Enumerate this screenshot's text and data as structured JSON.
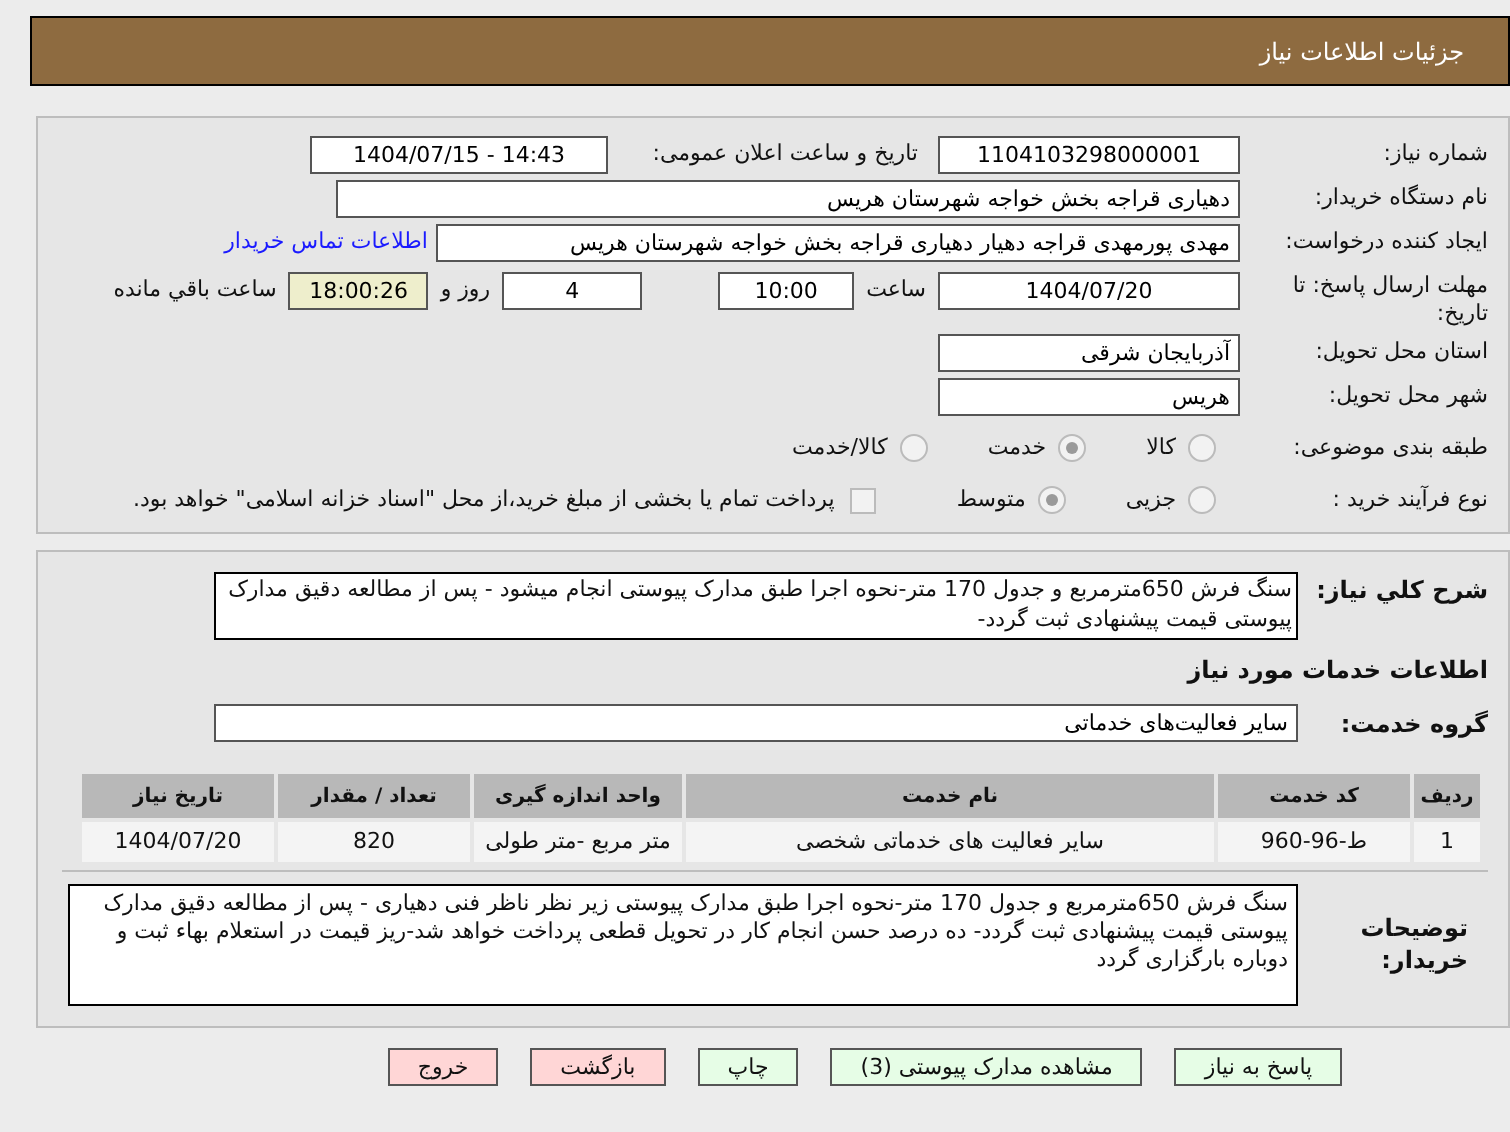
{
  "header": {
    "title": "جزئیات اطلاعات نیاز"
  },
  "details": {
    "need_number": {
      "label": "شماره نیاز:",
      "value": "1104103298000001"
    },
    "announce_date": {
      "label": "تاریخ و ساعت اعلان عمومی:",
      "value": "1404/07/15 - 14:43"
    },
    "buyer_org": {
      "label": "نام دستگاه خریدار:",
      "value": "دهیاری قراجه بخش خواجه شهرستان هریس"
    },
    "creator": {
      "label": "ایجاد کننده درخواست:",
      "value": "مهدی پورمهدی قراجه دهیار دهیاری قراجه بخش خواجه شهرستان هریس",
      "link": "اطلاعات تماس خریدار"
    },
    "deadline": {
      "label": "مهلت ارسال پاسخ: تا تاریخ:",
      "date": "1404/07/20",
      "time_label": "ساعت",
      "time": "10:00",
      "days": "4",
      "days_label": "روز و",
      "remaining": "18:00:26",
      "remaining_label": "ساعت باقي مانده"
    },
    "province": {
      "label": "استان محل تحویل:",
      "value": "آذربایجان شرقی"
    },
    "city": {
      "label": "شهر محل تحویل:",
      "value": "هریس"
    },
    "category": {
      "label": "طبقه بندی موضوعی:",
      "options": [
        {
          "label": "کالا",
          "selected": false
        },
        {
          "label": "خدمت",
          "selected": true
        },
        {
          "label": "کالا/خدمت",
          "selected": false
        }
      ]
    },
    "process": {
      "label": "نوع فرآیند خرید :",
      "options": [
        {
          "label": "جزیی",
          "selected": false
        },
        {
          "label": "متوسط",
          "selected": true
        }
      ],
      "payment": {
        "label": "پرداخت تمام یا بخشی از مبلغ خرید،از محل \"اسناد خزانه اسلامی\" خواهد بود.",
        "checked": false
      }
    }
  },
  "summary": {
    "label": "شرح کلي نیاز:",
    "value": "سنگ فرش 650مترمربع و جدول 170 متر-نحوه اجرا طبق مدارک پیوستی  انجام میشود - پس از مطالعه دقیق مدارک پیوستی قیمت پیشنهادی ثبت گردد-"
  },
  "services": {
    "title": "اطلاعات خدمات مورد نیاز",
    "group_label": "گروه خدمت:",
    "group": "سایر فعالیت‌های خدماتی",
    "columns": [
      "ردیف",
      "کد خدمت",
      "نام خدمت",
      "واحد اندازه گیری",
      "تعداد / مقدار",
      "تاریخ نیاز"
    ],
    "rows": [
      [
        "1",
        "ط-96-960",
        "سایر فعالیت های خدماتی شخصی",
        "متر مربع -متر طولی",
        "820",
        "1404/07/20"
      ]
    ]
  },
  "buyer_notes": {
    "label": "توضیحات خریدار:",
    "value": "سنگ فرش 650مترمربع و جدول 170 متر-نحوه اجرا طبق مدارک پیوستی زیر نظر ناظر فنی دهیاری - پس از مطالعه دقیق مدارک پیوستی قیمت پیشنهادی ثبت گردد- ده درصد حسن انجام کار در تحویل قطعی پرداخت خواهد شد-ریز قیمت در استعلام بهاء  ثبت و دوباره بارگزاری گردد"
  },
  "buttons": [
    {
      "label": "پاسخ به نیاز",
      "kind": "action"
    },
    {
      "label": "مشاهده مدارک پیوستی (3)",
      "kind": "action"
    },
    {
      "label": "چاپ",
      "kind": "action"
    },
    {
      "label": "بازگشت",
      "kind": "exit"
    },
    {
      "label": "خروج",
      "kind": "exit"
    }
  ]
}
